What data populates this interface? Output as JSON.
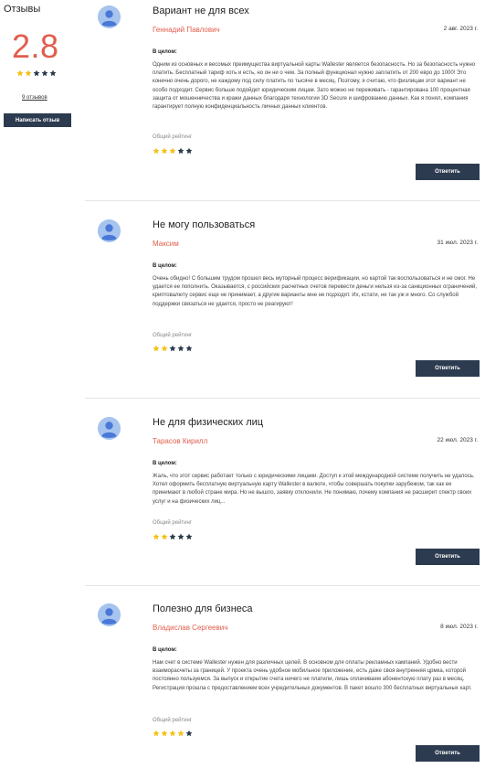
{
  "sidebar": {
    "title": "Отзывы",
    "rating": "2.8",
    "stars_filled": 2,
    "stars_total": 5,
    "reviews_count": "9 отзывов",
    "write_button": "Написать отзыв"
  },
  "colors": {
    "accent": "#e15d4c",
    "button": "#2c3b4f",
    "star_filled": "#f4c11a",
    "star_empty": "#2c3b4f",
    "avatar_bg": "#a6c4ee",
    "avatar_fg": "#4a78d6"
  },
  "reviews": [
    {
      "title": "Вариант не для всех",
      "author": "Геннадий Павлович",
      "date": "2 авг. 2023 г.",
      "in_general_label": "В целом:",
      "text": "Одним из основных и весомых преимущества виртуальной карты Wallester является безопасность. Но за безопасность нужно платить. Бесплатный тариф хоть и есть, но он ни о чем. За полный функционал нужно заплатить от 200 евро до 1000! Это конечно очень дорого, не каждому под силу платить по тысяче в месяц. Поэтому, я считаю, что физлицам этот вариант не особо подходит. Сервис больше подойдет юридическим лицам. Зато можно не переживать - гарантирована 100 процентная защита от мошенничества и кражи данных благодаря технологии 3D Secure и шифрованию данных. Как я понял, компания гарантирует полную конфиденциальность личных данных клиентов.",
      "rating_label": "Общий рейтинг",
      "stars_filled": 3,
      "reply_button": "Ответить"
    },
    {
      "title": "Не могу пользоваться",
      "author": "Максим",
      "date": "31 июл. 2023 г.",
      "in_general_label": "В целом:",
      "text": "Очень обидно! С большим трудом прошел весь муторный процесс верификации, но картой так воспользоваться и не смог. Не удается ее пополнить. Оказывается, с российских расчетных счетов перевести деньги нельзя из-за санкционных ограничений, криптовалюту сервис еще не принимает, а другие варианты мне не подходят. Их, кстати, не так уж и много. Со службой поддержки связаться не удается, просто не реагируют!",
      "rating_label": "Общий рейтинг",
      "stars_filled": 2,
      "reply_button": "Ответить"
    },
    {
      "title": "Не для физических лиц",
      "author": "Тарасов Кирилл",
      "date": "22 июл. 2023 г.",
      "in_general_label": "В целом:",
      "text": "Жаль, что этот сервис работает только с юридическими лицами. Доступ к этой международной системе получить не удалось. Хотел оформить бесплатную виртуальную карту Wallester в валюте, чтобы совершать покупки зарубежом, так как ее принимают в любой стране мира. Но не вышло, заявку отклонили. Не понимаю, почему компания не расширит спектр своих услуг и на физических лиц...",
      "rating_label": "Общий рейтинг",
      "stars_filled": 2,
      "reply_button": "Ответить"
    },
    {
      "title": "Полезно для бизнеса",
      "author": "Владислав Сергеевич",
      "date": "8 июл. 2023 г.",
      "in_general_label": "В целом:",
      "text": "Нам счет в системе Wallester нужен для различных целей. В основном для оплаты рекламных кампаний. Удобно вести взаиморасчеты за границей. У проекта очень удобное мобильное приложение, есть даже своя внутренняя црмка, которой постоянно пользуемся. За выпуск и открытие счета ничего не платили, лишь оплачиваем абонентскую плату раз в месяц. Регистрация прошла с предоставлением всех учредительных документов. В пакет вошло 300 бесплатных виртуальных карт.",
      "rating_label": "Общий рейтинг",
      "stars_filled": 4,
      "reply_button": "Ответить"
    }
  ]
}
